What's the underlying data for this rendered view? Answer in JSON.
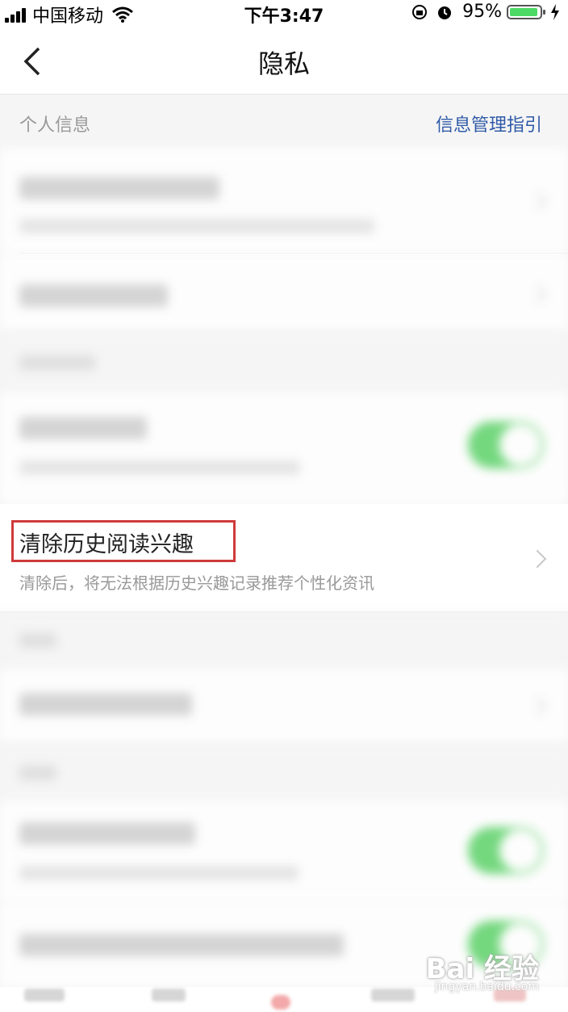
{
  "status_bar": {
    "carrier": "中国移动",
    "time": "下午3:47",
    "battery": "95%",
    "battery_level": 0.95
  },
  "nav": {
    "title": "隐私"
  },
  "personal_info": {
    "section_title": "个人信息",
    "guide_link": "信息管理指引"
  },
  "clear_history": {
    "title": "清除历史阅读兴趣",
    "description": "清除后，将无法根据历史兴趣记录推荐个性化资讯"
  },
  "toggles": {
    "toggle_1_on": true,
    "toggle_2_on": true,
    "toggle_3_on": true
  },
  "colors": {
    "link": "#2f5aa8",
    "toggle_on": "#5ed36a",
    "highlight": "#d03a3a"
  },
  "watermark": {
    "brand": "Bai 经验",
    "url": "jingyan.baidu.com"
  }
}
